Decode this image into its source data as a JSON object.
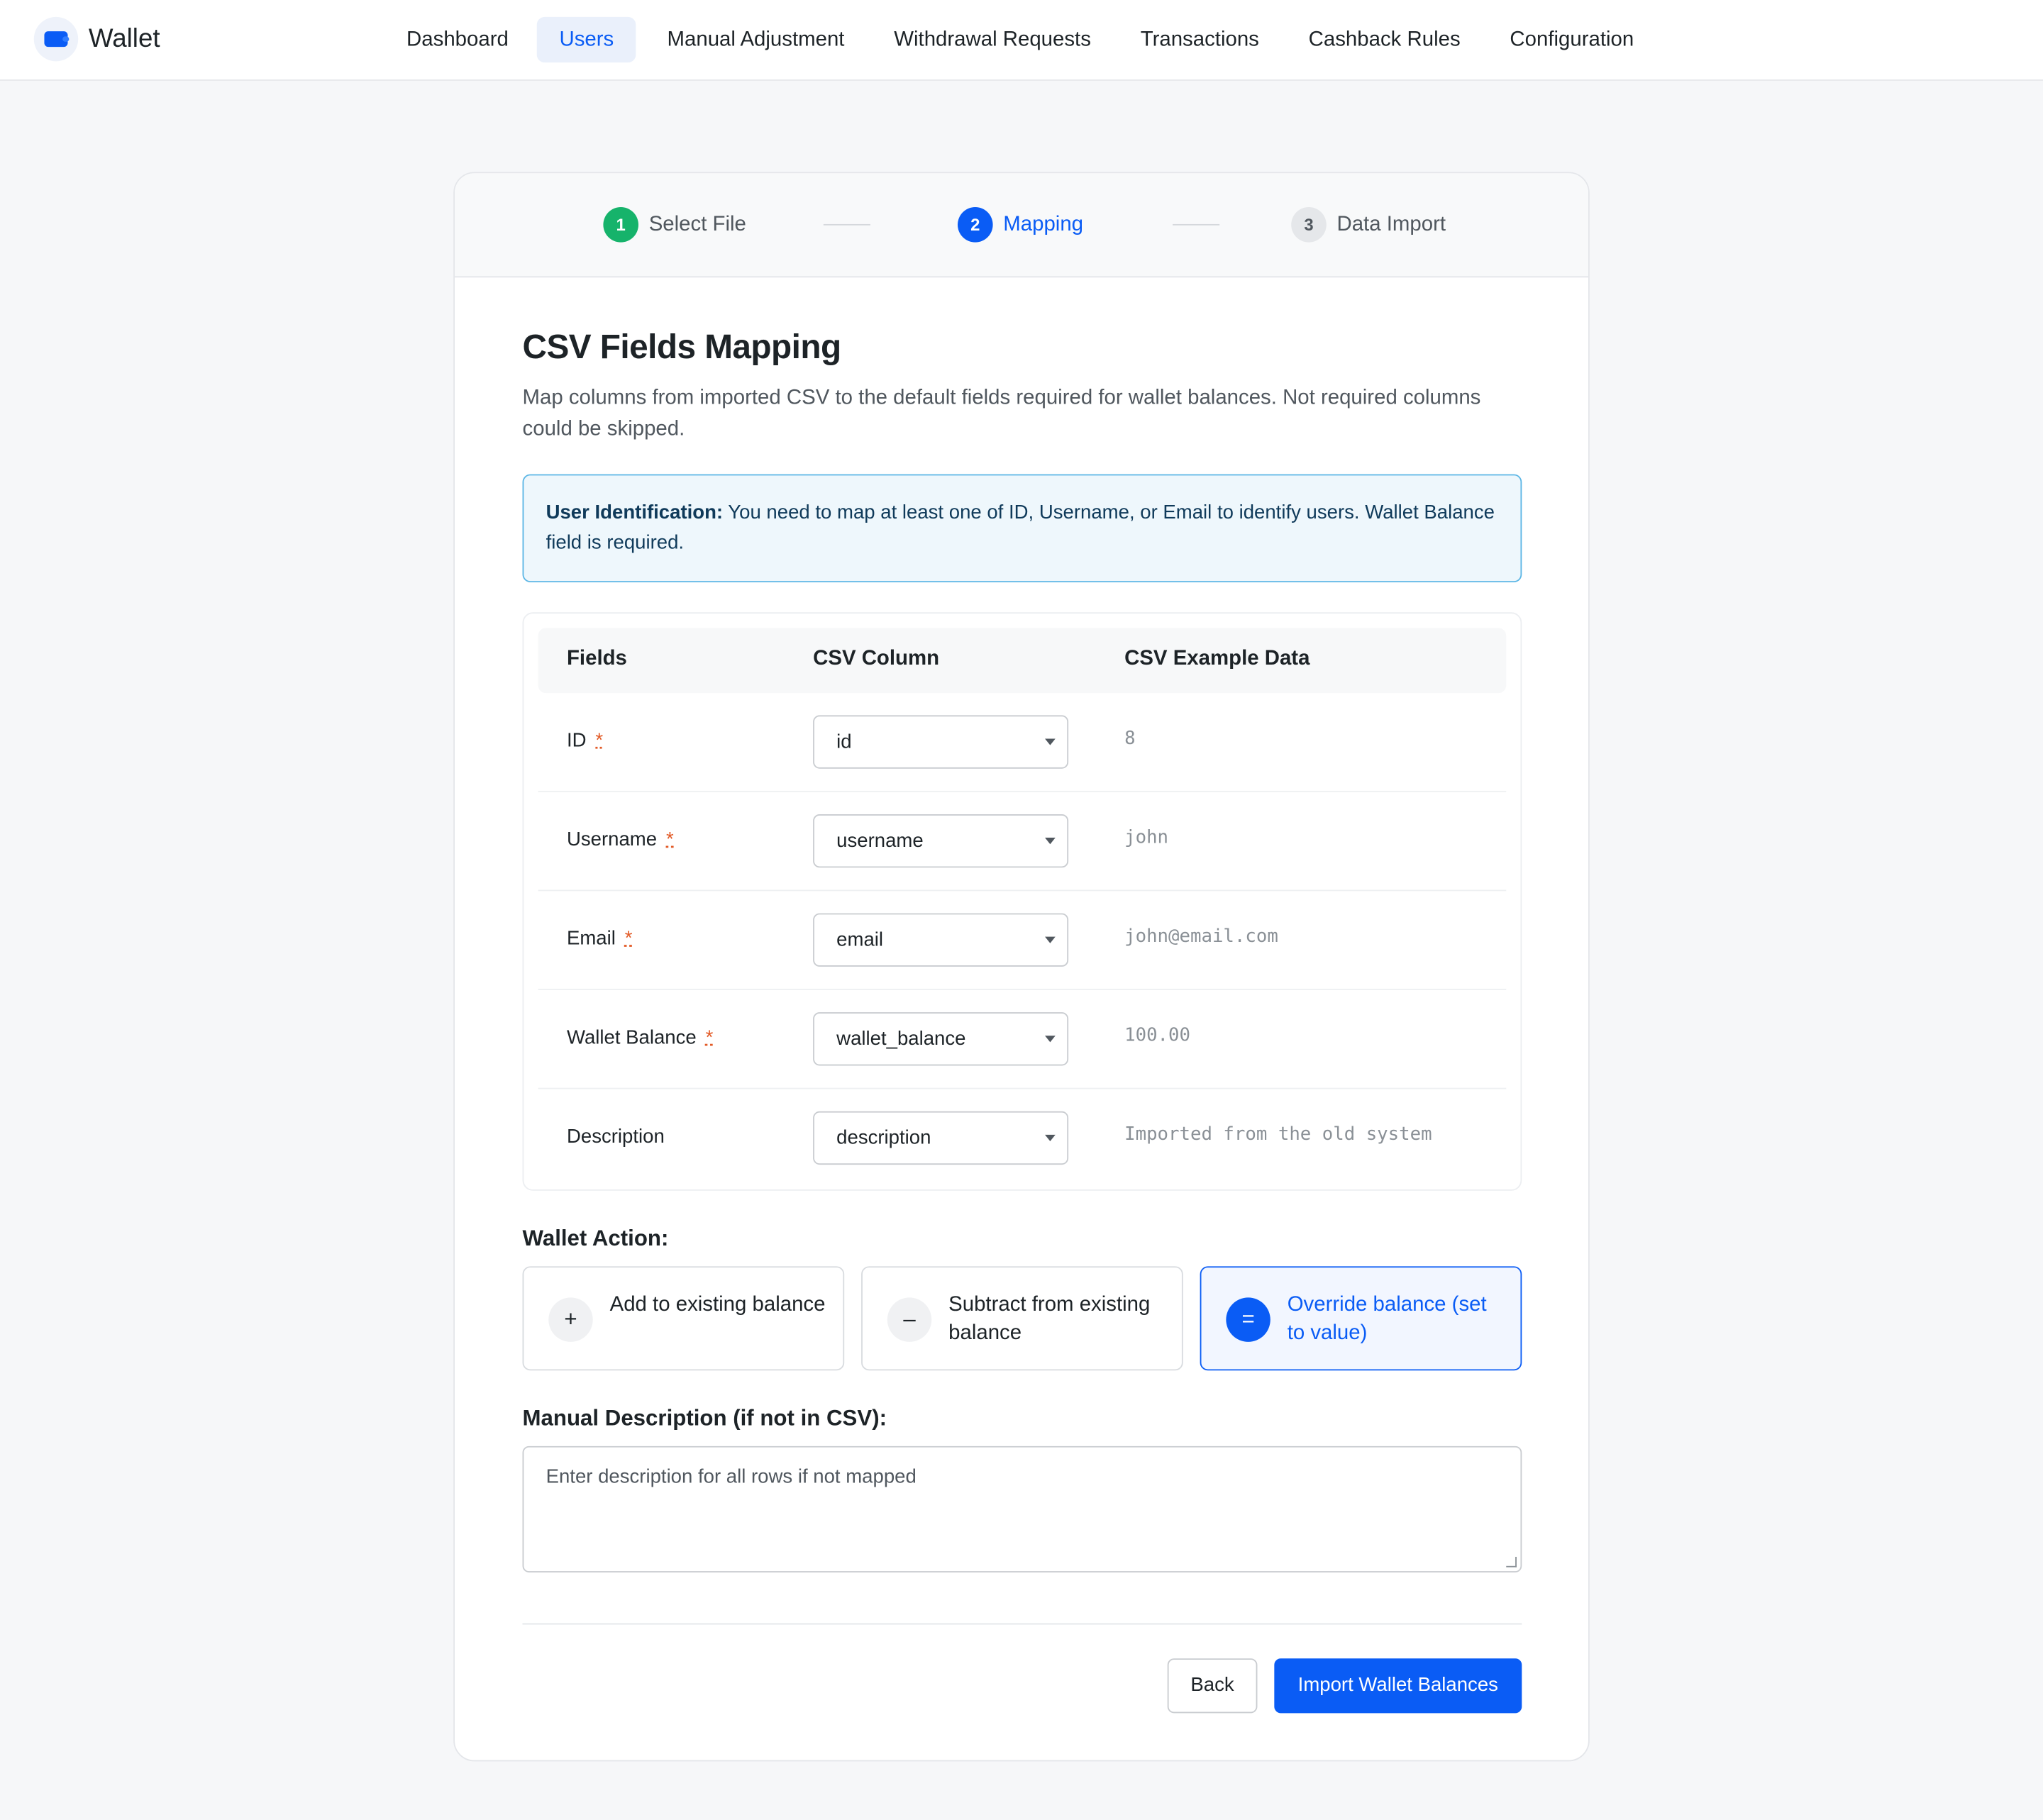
{
  "app": {
    "name": "Wallet",
    "logo_icon": "wallet-icon",
    "accent": "#0a5cf5"
  },
  "nav": {
    "items": [
      {
        "label": "Dashboard",
        "active": false
      },
      {
        "label": "Users",
        "active": true
      },
      {
        "label": "Manual Adjustment",
        "active": false
      },
      {
        "label": "Withdrawal Requests",
        "active": false
      },
      {
        "label": "Transactions",
        "active": false
      },
      {
        "label": "Cashback Rules",
        "active": false
      },
      {
        "label": "Configuration",
        "active": false
      }
    ]
  },
  "stepper": {
    "steps": [
      {
        "num": "1",
        "label": "Select File",
        "state": "done"
      },
      {
        "num": "2",
        "label": "Mapping",
        "state": "current"
      },
      {
        "num": "3",
        "label": "Data Import",
        "state": "todo"
      }
    ]
  },
  "page": {
    "title": "CSV Fields Mapping",
    "subtitle": "Map columns from imported CSV to the default fields required for wallet balances. Not required columns could be skipped."
  },
  "notice": {
    "label": "User Identification:",
    "text": " You need to map at least one of ID, Username, or Email to identify users. Wallet Balance field is required."
  },
  "table": {
    "headers": {
      "fields": "Fields",
      "csv_column": "CSV Column",
      "example": "CSV Example Data"
    },
    "rows": [
      {
        "field": "ID",
        "required": true,
        "column": "id",
        "example": "8"
      },
      {
        "field": "Username",
        "required": true,
        "column": "username",
        "example": "john"
      },
      {
        "field": "Email",
        "required": true,
        "column": "email",
        "example": "john@email.com"
      },
      {
        "field": "Wallet Balance",
        "required": true,
        "column": "wallet_balance",
        "example": "100.00"
      },
      {
        "field": "Description",
        "required": false,
        "column": "description",
        "example": "Imported from the old system"
      }
    ]
  },
  "wallet_action": {
    "label": "Wallet Action:",
    "options": [
      {
        "icon": "+",
        "icon_name": "plus-icon",
        "label": "Add to existing balance",
        "selected": false
      },
      {
        "icon": "–",
        "icon_name": "minus-icon",
        "label": "Subtract from existing balance",
        "selected": false
      },
      {
        "icon": "=",
        "icon_name": "equals-icon",
        "label": "Override balance (set to value)",
        "selected": true
      }
    ]
  },
  "manual_description": {
    "label": "Manual Description (if not in CSV):",
    "placeholder": "Enter description for all rows if not mapped"
  },
  "footer": {
    "back_label": "Back",
    "import_label": "Import Wallet Balances"
  },
  "required_marker": "*"
}
